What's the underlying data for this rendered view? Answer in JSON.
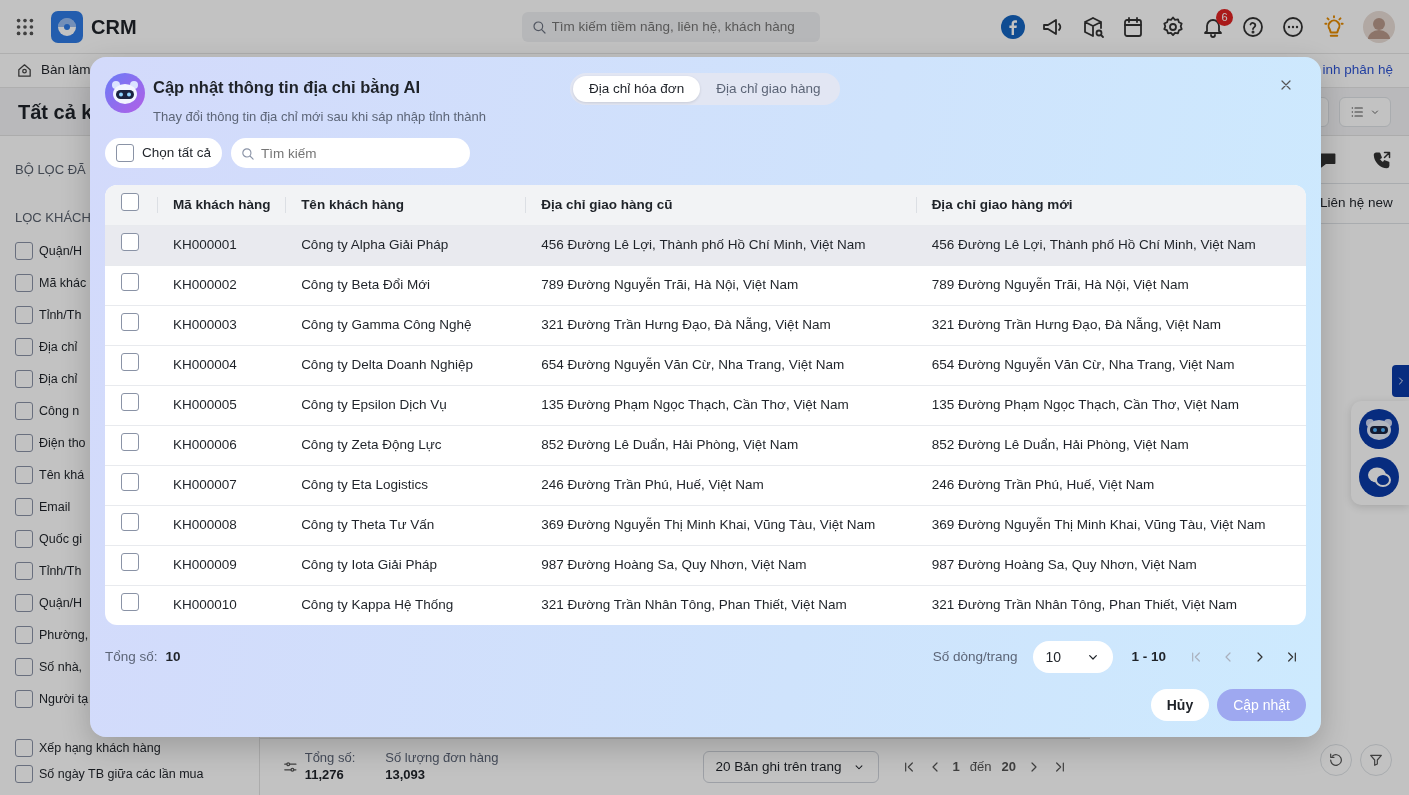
{
  "topbar": {
    "app_name": "CRM",
    "search": {
      "placeholder": "Tìm kiếm tiềm năng, liên hệ, khách hàng"
    },
    "notification_count": "6"
  },
  "nav": {
    "home_label": "Bàn làm",
    "right_link": "inh phân hệ"
  },
  "page": {
    "title": "Tất cả k"
  },
  "sidebar": {
    "section_1": "BỘ LỌC ĐÃ",
    "section_2": "LỌC KHÁCH",
    "filters": [
      {
        "label": "Quận/H",
        "checked": false
      },
      {
        "label": "Mã khác",
        "checked": false
      },
      {
        "label": "Tỉnh/Th",
        "checked": false
      },
      {
        "label": "Địa chỉ",
        "checked": false
      },
      {
        "label": "Địa chỉ",
        "checked": false
      },
      {
        "label": "Công n",
        "checked": false
      },
      {
        "label": "Điện tho",
        "checked": false
      },
      {
        "label": "Tên khá",
        "checked": false
      },
      {
        "label": "Email",
        "checked": false
      },
      {
        "label": "Quốc gi",
        "checked": false
      },
      {
        "label": "Tỉnh/Th",
        "checked": false
      },
      {
        "label": "Quận/H",
        "checked": false
      },
      {
        "label": "Phường,",
        "checked": false
      },
      {
        "label": "Số nhà,",
        "checked": false
      },
      {
        "label": "Người tạ",
        "checked": false
      },
      {
        "label": "Xếp hạng khách hàng",
        "checked": false
      },
      {
        "label": "Số ngày TB giữa các lần mua",
        "checked": false
      }
    ]
  },
  "right_panel": {
    "column_label": "Liên hệ new"
  },
  "footer_bar": {
    "total_label": "Tổng số:",
    "total": "11,276",
    "orders_label": "Số lượng đơn hàng",
    "orders": "13,093",
    "page_size": "20 Bản ghi trên trang",
    "page_current": "1",
    "page_sep": "đến",
    "page_total": "20"
  },
  "modal": {
    "title": "Cập nhật thông tin địa chỉ bằng AI",
    "subtitle": "Thay đổi thông tin địa chỉ mới sau khi sáp nhập tỉnh thành",
    "tabs": [
      {
        "label": "Địa chỉ hóa đơn",
        "selected": true
      },
      {
        "label": "Địa chỉ giao hàng",
        "selected": false
      }
    ],
    "select_all": {
      "label": "Chọn tất cả",
      "checked": false
    },
    "search": {
      "placeholder": "Tìm kiếm"
    },
    "table": {
      "header_checked": false,
      "columns": [
        "Mã khách hàng",
        "Tên khách hàng",
        "Địa chỉ giao hàng cũ",
        "Địa chỉ giao hàng mới"
      ],
      "rows": [
        {
          "code": "KH000001",
          "name": "Công ty Alpha Giải Pháp",
          "old_address": "456 Đường Lê Lợi, Thành phố Hồ Chí Minh, Việt Nam",
          "new_address": "456 Đường Lê Lợi, Thành phố Hồ Chí Minh, Việt Nam",
          "checked": false,
          "hovered": true
        },
        {
          "code": "KH000002",
          "name": "Công ty Beta Đổi Mới",
          "old_address": "789 Đường Nguyễn Trãi, Hà Nội, Việt Nam",
          "new_address": "789 Đường Nguyễn Trãi, Hà Nội, Việt Nam",
          "checked": false,
          "hovered": false
        },
        {
          "code": "KH000003",
          "name": "Công ty Gamma Công Nghệ",
          "old_address": "321 Đường Trần Hưng Đạo, Đà Nẵng, Việt Nam",
          "new_address": "321 Đường Trần Hưng Đạo, Đà Nẵng, Việt Nam",
          "checked": false,
          "hovered": false
        },
        {
          "code": "KH000004",
          "name": "Công ty Delta Doanh Nghiệp",
          "old_address": "654 Đường Nguyễn Văn Cừ, Nha Trang, Việt Nam",
          "new_address": "654 Đường Nguyễn Văn Cừ, Nha Trang, Việt Nam",
          "checked": false,
          "hovered": false
        },
        {
          "code": "KH000005",
          "name": "Công ty Epsilon Dịch Vụ",
          "old_address": "135 Đường Phạm Ngọc Thạch, Cần Thơ, Việt Nam",
          "new_address": "135 Đường Phạm Ngọc Thạch, Cần Thơ, Việt Nam",
          "checked": false,
          "hovered": false
        },
        {
          "code": "KH000006",
          "name": "Công ty Zeta Động Lực",
          "old_address": "852 Đường Lê Duẩn, Hải Phòng, Việt Nam",
          "new_address": "852 Đường Lê Duẩn, Hải Phòng, Việt Nam",
          "checked": false,
          "hovered": false
        },
        {
          "code": "KH000007",
          "name": "Công ty Eta Logistics",
          "old_address": "246 Đường Trần Phú, Huế, Việt Nam",
          "new_address": "246 Đường Trần Phú, Huế, Việt Nam",
          "checked": false,
          "hovered": false
        },
        {
          "code": "KH000008",
          "name": "Công ty Theta Tư Vấn",
          "old_address": "369 Đường Nguyễn Thị Minh Khai, Vũng Tàu, Việt Nam",
          "new_address": "369 Đường Nguyễn Thị Minh Khai, Vũng Tàu, Việt Nam",
          "checked": false,
          "hovered": false
        },
        {
          "code": "KH000009",
          "name": "Công ty Iota Giải Pháp",
          "old_address": "987 Đường Hoàng Sa, Quy Nhơn, Việt Nam",
          "new_address": "987 Đường Hoàng Sa, Quy Nhơn, Việt Nam",
          "checked": false,
          "hovered": false
        },
        {
          "code": "KH000010",
          "name": "Công ty Kappa Hệ Thống",
          "old_address": "321 Đường Trần Nhân Tông, Phan Thiết, Việt Nam",
          "new_address": "321 Đường Trần Nhân Tông, Phan Thiết, Việt Nam",
          "checked": false,
          "hovered": false
        }
      ]
    },
    "footer": {
      "total_label": "Tổng số:",
      "total": "10",
      "rows_label": "Số dòng/trang",
      "page_size": "10",
      "range": "1 - 10"
    },
    "buttons": [
      {
        "label": "Hủy",
        "disabled": false
      },
      {
        "label": "Cập nhật",
        "disabled": true
      }
    ]
  }
}
